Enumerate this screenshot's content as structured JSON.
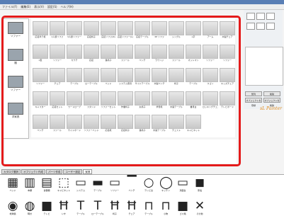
{
  "menu": [
    "ファイル(F)",
    "編集(E)",
    "表示(V)",
    "設定(S)",
    "ヘルプ(H)"
  ],
  "left_panel": {
    "categories": [
      {
        "label": "ソファー"
      },
      {
        "label": "棚"
      },
      {
        "label": "ソファー"
      },
      {
        "label": "洋家具"
      }
    ]
  },
  "grid_cells": [
    "応接半テ机",
    "1人掛ソファ",
    "3人掛ソファー",
    "応接椅子",
    "応接ソファ(R)",
    "応接ソファー(L)",
    "応接テーブル",
    "3P ソファ",
    "シングル",
    "L字",
    "アーム",
    "木製チェア",
    "L型",
    "ソファー",
    "カウチ",
    "応接",
    "長椅子",
    "スツール",
    "ベンチ",
    "ラウンジ",
    "スツール",
    "オットマン",
    "ソファー",
    "ソファー",
    "ソファー",
    "チェア",
    "テーブル",
    "ローテーブル",
    "ベッド",
    "システム家具",
    "サイドテーブル",
    "木製ベンチ",
    "椅子",
    "テーブル",
    "ワゴン",
    "キッズチェア",
    "キャスター",
    "応接セット",
    "ワードローブ",
    "スタンド",
    "ソファーセット",
    "作業椅子",
    "丸椅子",
    "学習机",
    "木製テーブル",
    "書見台",
    "ロッキングチェア",
    "テレビボード",
    "ベンチ",
    "スツール",
    "サイドボード",
    "ソファーベッド",
    "応接机",
    "応接椅子",
    "長椅子",
    "木製テーブル",
    "チェスト",
    "キャビネット"
  ],
  "right_panel": {
    "tools": [
      "選択",
      "移動",
      "回転",
      "拡大",
      "縮小",
      "表示"
    ],
    "buttons": [
      "整列",
      "削除",
      "オブジェクトを登録",
      "オブジェクトを削除"
    ],
    "brand": "sL Painter"
  },
  "bottom_tabs": [
    {
      "label": "カタログ選択",
      "active": false
    },
    {
      "label": "オブジェクト作成",
      "active": false
    },
    {
      "label": "パーツ作成",
      "active": false
    },
    {
      "label": "ユーザー設定",
      "active": false
    },
    {
      "label": "家具",
      "active": true
    }
  ],
  "bottom_items": [
    "ベッド",
    "本棚",
    "食器棚",
    "キャビネット",
    "システム",
    "テーブル",
    "ソファー",
    "ベンチ",
    "テレビ台",
    "キッチン",
    "洗面台",
    "家電",
    "地球儀",
    "時計",
    "テレビ",
    "いす",
    "テーブル",
    "ローテーブル",
    "椅子",
    "チェア",
    "テーブル",
    "小物",
    "ゴミ箱",
    "その他"
  ]
}
